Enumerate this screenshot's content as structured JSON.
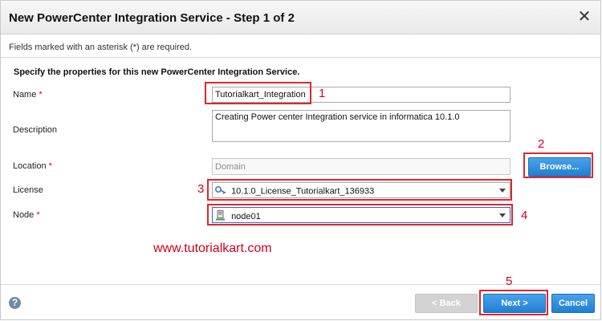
{
  "dialog": {
    "title": "New PowerCenter Integration Service - Step 1 of 2",
    "close_glyph": "✕",
    "required_note": "Fields marked with an asterisk (*) are required.",
    "intro": "Specify the properties for this new PowerCenter Integration Service."
  },
  "form": {
    "name": {
      "label": "Name",
      "asterisk": "*",
      "value": "Tutorialkart_Integration"
    },
    "description": {
      "label": "Description",
      "value": "Creating Power center Integration service in informatica 10.1.0"
    },
    "location": {
      "label": "Location",
      "asterisk": "*",
      "value": "Domain"
    },
    "license": {
      "label": "License",
      "value": "10.1.0_License_Tutorialkart_136933",
      "icon": "key-icon"
    },
    "node": {
      "label": "Node",
      "asterisk": "*",
      "value": "node01",
      "icon": "node-server-icon"
    },
    "browse_label": "Browse..."
  },
  "annotations": {
    "n1": "1",
    "n2": "2",
    "n3": "3",
    "n4": "4",
    "n5": "5",
    "color": "#e0262d",
    "watermark": "www.tutorialkart.com"
  },
  "footer": {
    "help_glyph": "?",
    "back_label": "< Back",
    "next_label": "Next >",
    "cancel_label": "Cancel"
  },
  "colors": {
    "accent": "#1f7fd1",
    "required": "#d0021b"
  }
}
